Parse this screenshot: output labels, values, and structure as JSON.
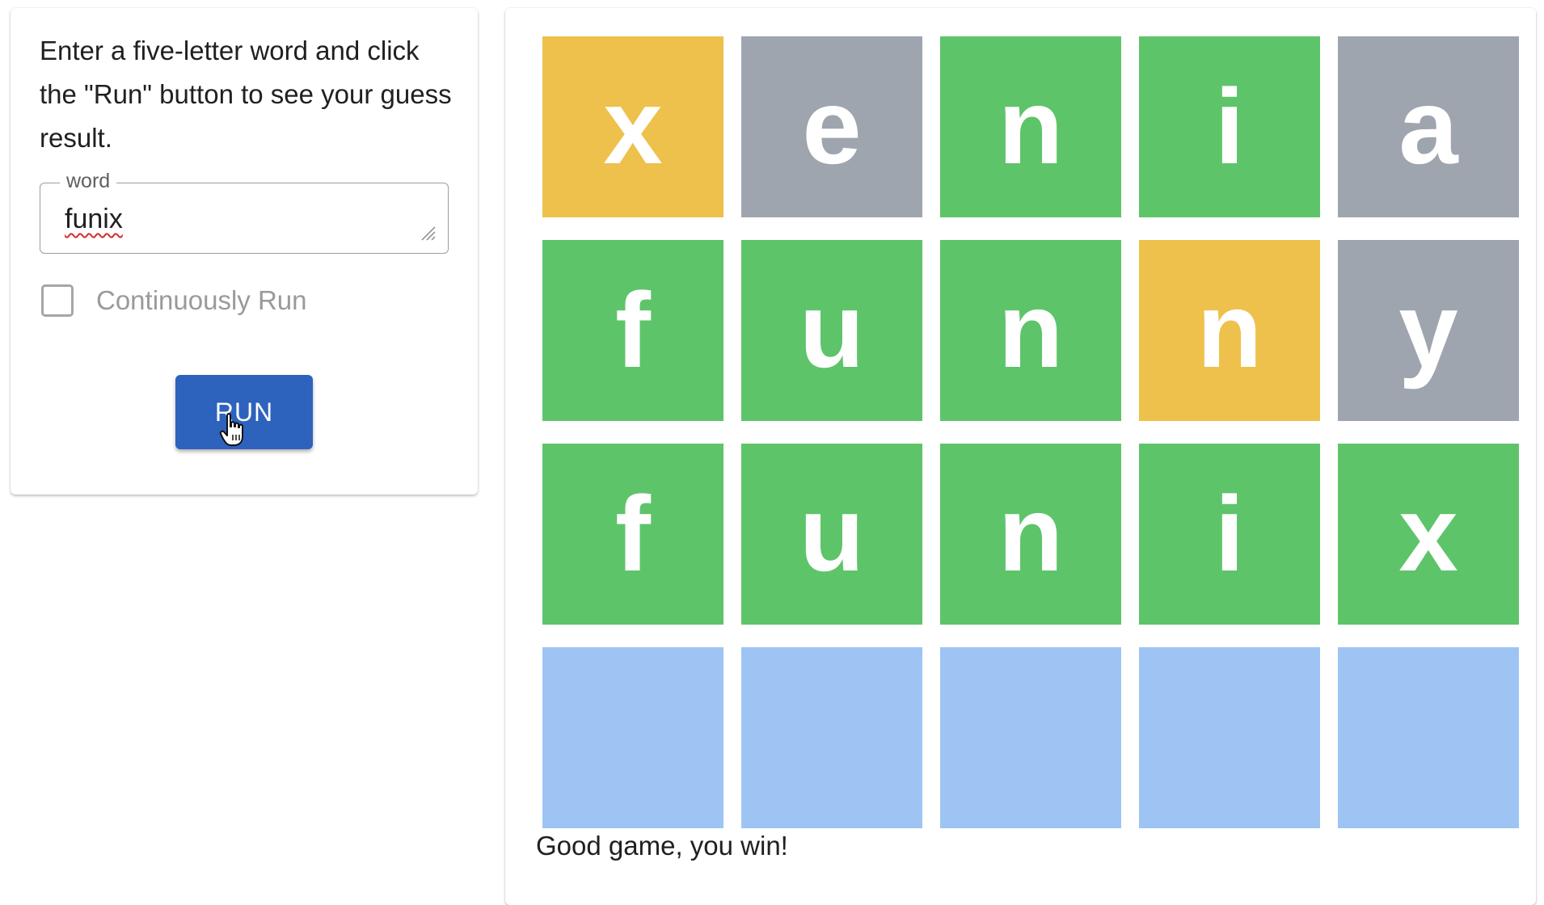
{
  "controls": {
    "instructions": "Enter a five-letter word and click the \"Run\" button to see your guess result.",
    "word_field": {
      "legend": "word",
      "value": "funix"
    },
    "continuous_run": {
      "label": "Continuously Run",
      "checked": false
    },
    "run_button": {
      "label": "RUN"
    }
  },
  "board": {
    "rows": [
      [
        {
          "letter": "x",
          "state": "yellow"
        },
        {
          "letter": "e",
          "state": "gray"
        },
        {
          "letter": "n",
          "state": "green"
        },
        {
          "letter": "i",
          "state": "green"
        },
        {
          "letter": "a",
          "state": "gray"
        }
      ],
      [
        {
          "letter": "f",
          "state": "green"
        },
        {
          "letter": "u",
          "state": "green"
        },
        {
          "letter": "n",
          "state": "green"
        },
        {
          "letter": "n",
          "state": "yellow"
        },
        {
          "letter": "y",
          "state": "gray"
        }
      ],
      [
        {
          "letter": "f",
          "state": "green"
        },
        {
          "letter": "u",
          "state": "green"
        },
        {
          "letter": "n",
          "state": "green"
        },
        {
          "letter": "i",
          "state": "green"
        },
        {
          "letter": "x",
          "state": "green"
        }
      ],
      [
        {
          "letter": "",
          "state": "empty"
        },
        {
          "letter": "",
          "state": "empty"
        },
        {
          "letter": "",
          "state": "empty"
        },
        {
          "letter": "",
          "state": "empty"
        },
        {
          "letter": "",
          "state": "empty"
        }
      ]
    ],
    "result_text": "Good game, you win!"
  },
  "colors": {
    "green": "#5ec46a",
    "yellow": "#eec14c",
    "gray": "#9ea5ae",
    "empty": "#9ec4f4",
    "accent": "#2d63bd"
  },
  "icons": {
    "resize_grip": "resize-grip-icon",
    "cursor": "hand-pointer-cursor-icon"
  }
}
